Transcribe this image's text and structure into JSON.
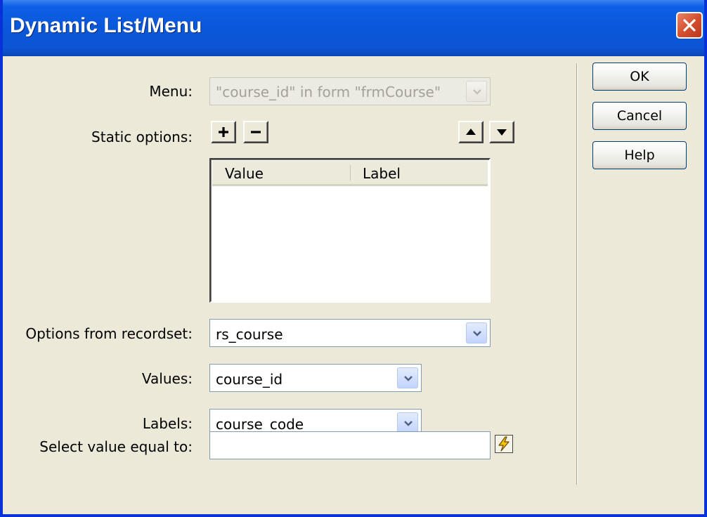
{
  "window": {
    "title": "Dynamic List/Menu"
  },
  "form": {
    "menu_label": "Menu:",
    "menu_value": "\"course_id\" in form \"frmCourse\"",
    "static_options_label": "Static options:",
    "table_headers": [
      "Value",
      "Label"
    ],
    "options_label": "Options from recordset:",
    "options_value": "rs_course",
    "values_label": "Values:",
    "values_value": "course_id",
    "labels_label": "Labels:",
    "labels_value": "course_code",
    "select_label": "Select value equal to:",
    "select_value": ""
  },
  "buttons": {
    "ok": "OK",
    "cancel": "Cancel",
    "help": "Help"
  },
  "icons": {
    "add": "plus-icon",
    "remove": "minus-icon",
    "up": "arrow-up-icon",
    "down": "arrow-down-icon",
    "dynamic_data": "lightning-bolt-icon",
    "close": "close-icon"
  },
  "colors": {
    "title_bar": "#0a57d8",
    "dialog_bg": "#ece9d8",
    "close_button": "#d5502f",
    "dropdown_arrow": "#4d6185"
  }
}
